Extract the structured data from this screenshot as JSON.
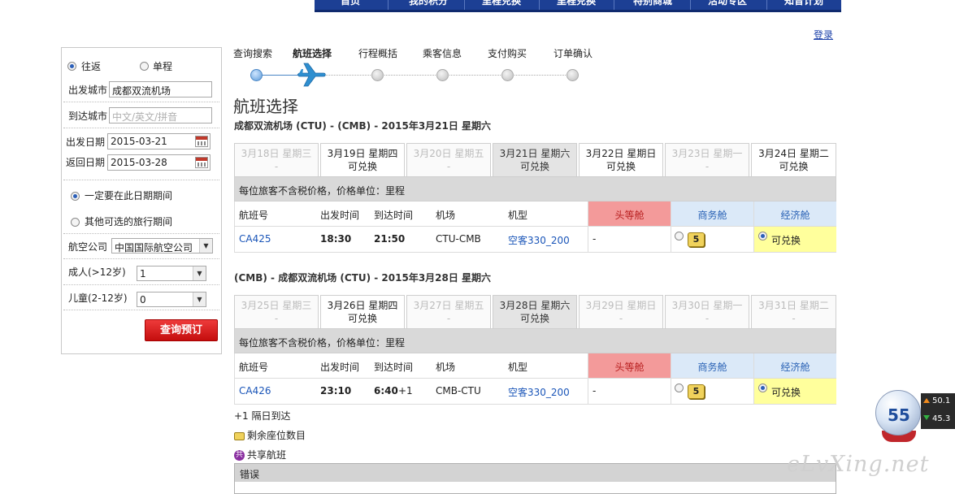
{
  "topnav": {
    "items": [
      "首页",
      "我的积分",
      "里程兑换",
      "里程兑换",
      "特别商城",
      "活动专区",
      "知音计划"
    ]
  },
  "header": {
    "login": "登录"
  },
  "search": {
    "round_trip": "往返",
    "one_way": "单程",
    "depart_city_label": "出发城市",
    "depart_city_value": "成都双流机场",
    "arrive_city_label": "到达城市",
    "arrive_city_placeholder": "中文/英文/拼音",
    "depart_date_label": "出发日期",
    "depart_date_value": "2015-03-21",
    "return_date_label": "返回日期",
    "return_date_value": "2015-03-28",
    "fixed_dates": "一定要在此日期期间",
    "flexible_dates": "其他可选的旅行期间",
    "airline_label": "航空公司",
    "airline_value": "中国国际航空公司",
    "adult_label": "成人(>12岁)",
    "adult_value": "1",
    "child_label": "儿童(2-12岁)",
    "child_value": "0",
    "submit": "查询预订"
  },
  "steps": [
    "查询搜索",
    "航班选择",
    "行程概括",
    "乘客信息",
    "支付购买",
    "订单确认"
  ],
  "page_title": "航班选择",
  "cabin_headers": {
    "flight_no": "航班号",
    "depart_time": "出发时间",
    "arrive_time": "到达时间",
    "airport": "机场",
    "aircraft": "机型",
    "first": "头等舱",
    "business": "商务舱",
    "economy": "经济舱"
  },
  "price_note": "每位旅客不含税价格，价格单位：里程",
  "outbound": {
    "title": "成都双流机场 (CTU) - (CMB) - 2015年3月21日 星期六",
    "dates": [
      {
        "label": "3月18日 星期三",
        "status": "-"
      },
      {
        "label": "3月19日 星期四",
        "status": "可兑换"
      },
      {
        "label": "3月20日 星期五",
        "status": "-"
      },
      {
        "label": "3月21日 星期六",
        "status": "可兑换"
      },
      {
        "label": "3月22日 星期日",
        "status": "可兑换"
      },
      {
        "label": "3月23日 星期一",
        "status": "-"
      },
      {
        "label": "3月24日 星期二",
        "status": "可兑换"
      }
    ],
    "flight": {
      "number": "CA425",
      "depart": "18:30",
      "arrive": "21:50",
      "arrive_suffix": "",
      "airport": "CTU-CMB",
      "aircraft": "空客330_200",
      "first": "-",
      "business_seats": "5",
      "economy": "可兑换"
    }
  },
  "inbound": {
    "title": "(CMB) - 成都双流机场 (CTU) - 2015年3月28日 星期六",
    "dates": [
      {
        "label": "3月25日 星期三",
        "status": "-"
      },
      {
        "label": "3月26日 星期四",
        "status": "可兑换"
      },
      {
        "label": "3月27日 星期五",
        "status": "-"
      },
      {
        "label": "3月28日 星期六",
        "status": "可兑换"
      },
      {
        "label": "3月29日 星期日",
        "status": "-"
      },
      {
        "label": "3月30日 星期一",
        "status": "-"
      },
      {
        "label": "3月31日 星期二",
        "status": "-"
      }
    ],
    "flight": {
      "number": "CA426",
      "depart": "23:10",
      "arrive": "6:40",
      "arrive_suffix": "+1",
      "airport": "CMB-CTU",
      "aircraft": "空客330_200",
      "first": "-",
      "business_seats": "5",
      "economy": "可兑换"
    }
  },
  "legend": {
    "next_day": "+1 隔日到达",
    "seats": "剩余座位数目",
    "shared": "共享航班"
  },
  "error": {
    "title": "错误"
  },
  "widget": {
    "score": "55",
    "up": "50.1",
    "down": "45.3"
  },
  "watermark": "eLvXing.net"
}
